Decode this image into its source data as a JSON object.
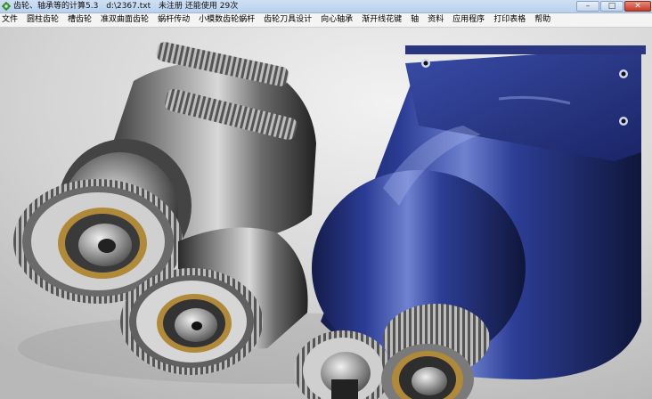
{
  "window": {
    "title_app": "齿轮、轴承等的计算5.3",
    "title_file": "d:\\2367.txt",
    "title_status": "未注册 还能使用 29次",
    "min_glyph": "–",
    "max_glyph": "□",
    "close_glyph": "✕"
  },
  "menu": {
    "items": [
      {
        "label": "文件"
      },
      {
        "label": "圆柱齿轮"
      },
      {
        "label": "槽齿轮"
      },
      {
        "label": "准双曲面齿轮"
      },
      {
        "label": "蜗杆传动"
      },
      {
        "label": "小模数齿轮蜗杆"
      },
      {
        "label": "齿轮刀具设计"
      },
      {
        "label": "向心轴承"
      },
      {
        "label": "渐开线花键"
      },
      {
        "label": "轴"
      },
      {
        "label": "资料"
      },
      {
        "label": "应用程序"
      },
      {
        "label": "打印表格"
      },
      {
        "label": "帮助"
      }
    ]
  },
  "icons": {
    "app": "gear-app-icon"
  },
  "colors": {
    "titlebar": "#c4d8f0",
    "motor_blue": "#2a3a8a",
    "gear_steel": "#6a6a6a",
    "bearing_brass": "#b08a3a",
    "background": "#d8d8d8"
  }
}
